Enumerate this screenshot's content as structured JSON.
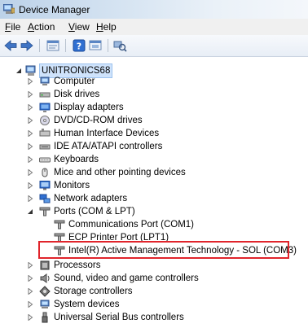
{
  "window": {
    "title": "Device Manager"
  },
  "menu": [
    {
      "label": "File",
      "key": "F",
      "rest": "ile"
    },
    {
      "label": "Action",
      "key": "A",
      "rest": "ction"
    },
    {
      "label": "View",
      "key": "V",
      "rest": "iew"
    },
    {
      "label": "Help",
      "key": "H",
      "rest": "elp"
    }
  ],
  "toolbar": [
    "back-icon",
    "forward-icon",
    "properties-icon",
    "help-icon",
    "update-driver-icon",
    "scan-hardware-icon"
  ],
  "tree": {
    "root": "UNITRONICS68",
    "categories": [
      "Computer",
      "Disk drives",
      "Display adapters",
      "DVD/CD-ROM drives",
      "Human Interface Devices",
      "IDE ATA/ATAPI controllers",
      "Keyboards",
      "Mice and other pointing devices",
      "Monitors",
      "Network adapters",
      "Ports (COM & LPT)",
      "Processors",
      "Sound, video and game controllers",
      "Storage controllers",
      "System devices",
      "Universal Serial Bus controllers"
    ],
    "ports": [
      "Communications Port (COM1)",
      "ECP Printer Port (LPT1)",
      "Intel(R) Active Management Technology - SOL (COM3)"
    ]
  },
  "colors": {
    "highlight": "#e0242b",
    "selection": "#cfe3fb"
  }
}
